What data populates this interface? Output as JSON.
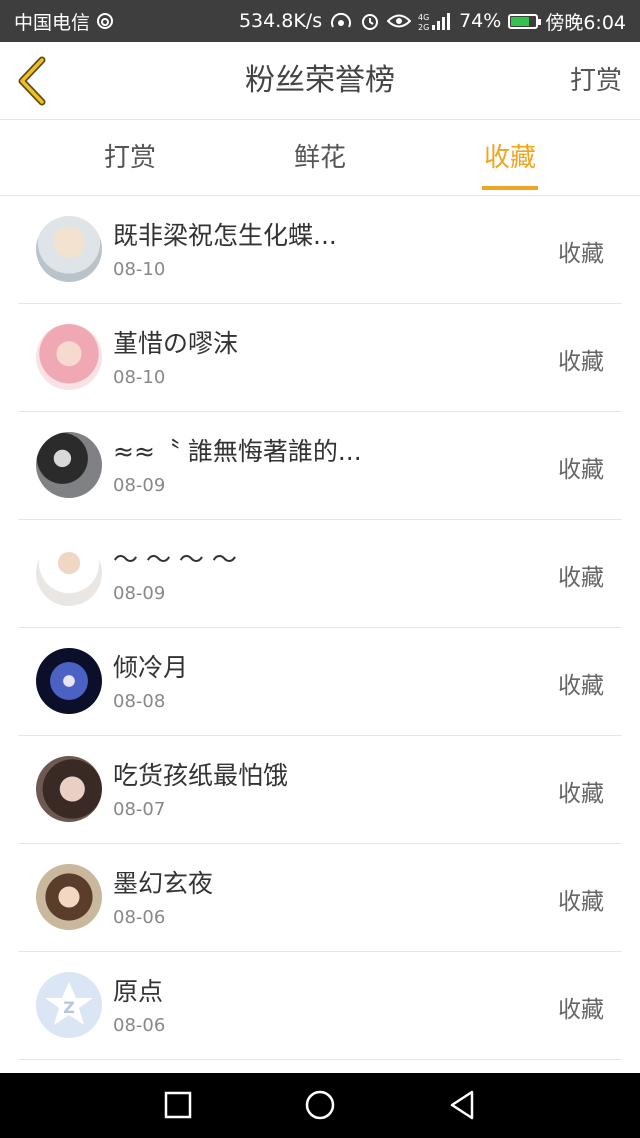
{
  "status_bar": {
    "carrier": "中国电信",
    "speed": "534.8K/s",
    "battery": "74%",
    "battery_level": 0.74,
    "time": "傍晚6:04",
    "icons": [
      "sync-icon",
      "hotspot-icon",
      "alarm-icon",
      "eye-icon",
      "signal-icon",
      "battery-icon"
    ]
  },
  "header": {
    "title": "粉丝荣誉榜",
    "action": "打赏"
  },
  "tabs": [
    {
      "label": "打赏"
    },
    {
      "label": "鲜花"
    },
    {
      "label": "收藏",
      "active": true
    }
  ],
  "list": [
    {
      "name": "既非梁祝怎生化蝶...",
      "date": "08-10",
      "action": "收藏"
    },
    {
      "name": "堇惜の嘐沫",
      "date": "08-10",
      "action": "收藏"
    },
    {
      "name": "≈≈〝 誰無悔著誰的...",
      "date": "08-09",
      "action": "收藏"
    },
    {
      "name": "～ ～ ～ ～",
      "date": "08-09",
      "action": "收藏"
    },
    {
      "name": "倾冷月",
      "date": "08-08",
      "action": "收藏"
    },
    {
      "name": "吃货孩纸最怕饿",
      "date": "08-07",
      "action": "收藏"
    },
    {
      "name": "墨幻玄夜",
      "date": "08-06",
      "action": "收藏"
    },
    {
      "name": "原点",
      "date": "08-06",
      "action": "收藏"
    }
  ],
  "colors": {
    "accent": "#f0a520",
    "status_bar_bg": "#3e3e3e",
    "nav_bar_bg": "#000000"
  }
}
